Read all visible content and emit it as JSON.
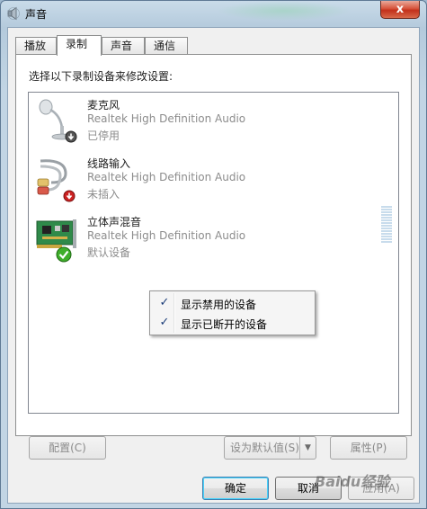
{
  "window": {
    "title": "声音",
    "close_label": "x"
  },
  "tabs": [
    {
      "label": "播放"
    },
    {
      "label": "录制"
    },
    {
      "label": "声音"
    },
    {
      "label": "通信"
    }
  ],
  "active_tab": "录制",
  "instruction": "选择以下录制设备来修改设置:",
  "devices": [
    {
      "name": "麦克风",
      "driver": "Realtek High Definition Audio",
      "status": "已停用",
      "icon": "microphone-icon",
      "badge": "disabled-badge-icon"
    },
    {
      "name": "线路输入",
      "driver": "Realtek High Definition Audio",
      "status": "未插入",
      "icon": "line-in-cable-icon",
      "badge": "unplugged-badge-icon"
    },
    {
      "name": "立体声混音",
      "driver": "Realtek High Definition Audio",
      "status": "默认设备",
      "icon": "sound-card-icon",
      "badge": "default-check-badge-icon"
    }
  ],
  "context_menu": {
    "items": [
      {
        "label": "显示禁用的设备",
        "checked": true
      },
      {
        "label": "显示已断开的设备",
        "checked": true
      }
    ]
  },
  "panel_buttons": {
    "configure": "配置(C)",
    "set_default": "设为默认值(S)",
    "properties": "属性(P)"
  },
  "dialog_buttons": {
    "ok": "确定",
    "cancel": "取消",
    "apply": "应用(A)"
  },
  "check_glyph": "✓",
  "dropdown_glyph": "▼",
  "watermark": "Baidu经验",
  "colors": {
    "title_bar": "#b4cadc",
    "close_button": "#c2301a",
    "disabled_text": "#8c8c8c",
    "checkmark": "#1e3f7a",
    "default_badge": "#3fae2a",
    "error_badge": "#cc2222"
  }
}
